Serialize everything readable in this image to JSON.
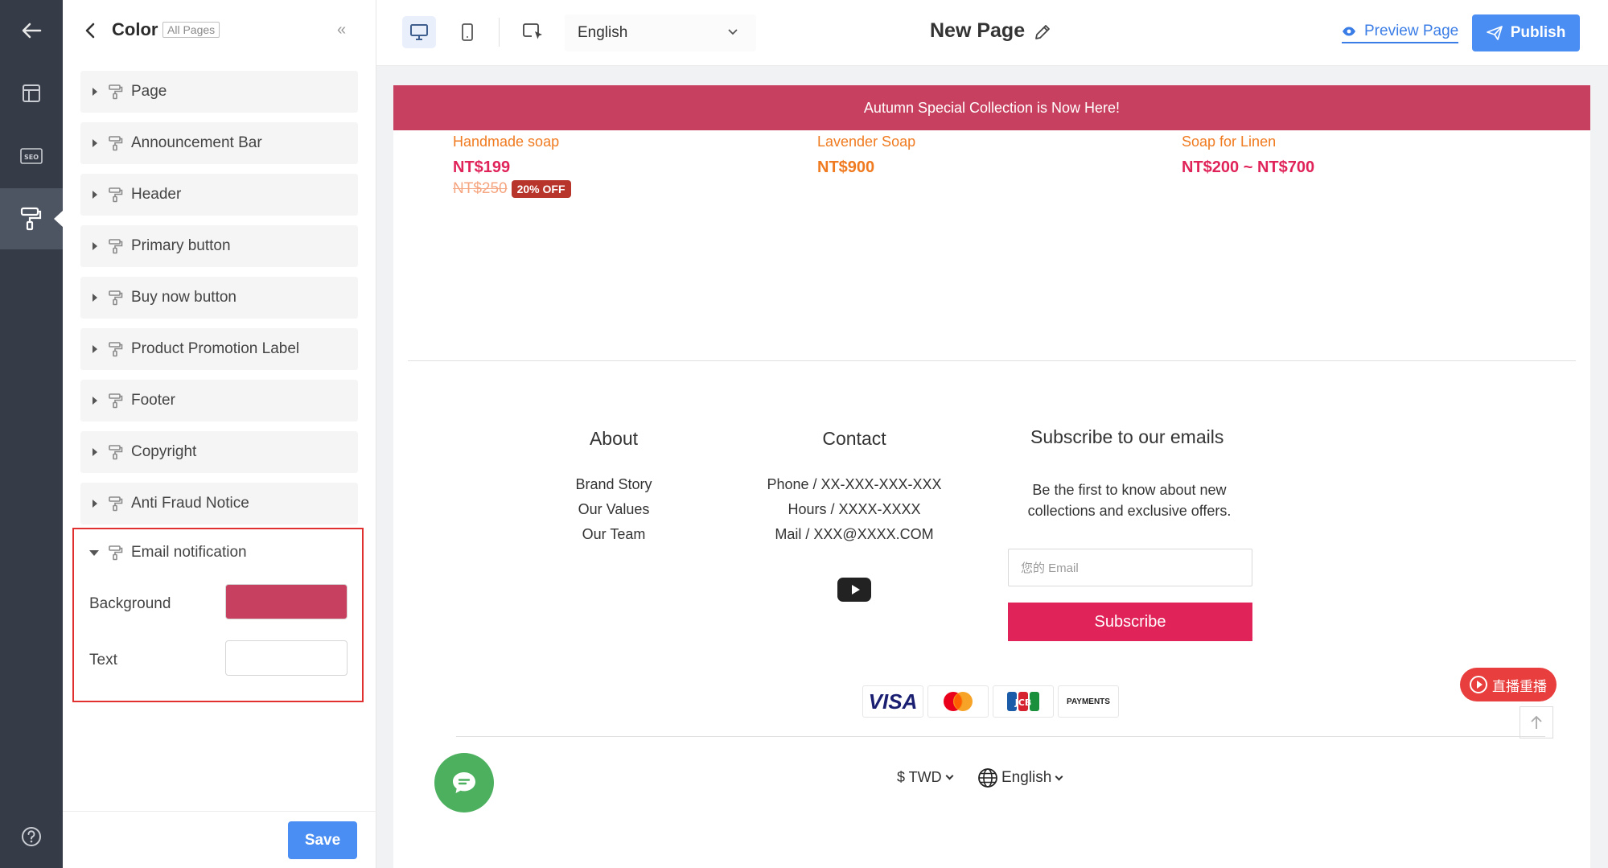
{
  "panel": {
    "title": "Color",
    "badge": "All Pages",
    "sections": [
      {
        "label": "Page"
      },
      {
        "label": "Announcement Bar"
      },
      {
        "label": "Header"
      },
      {
        "label": "Primary button"
      },
      {
        "label": "Buy now button"
      },
      {
        "label": "Product Promotion Label"
      },
      {
        "label": "Footer"
      },
      {
        "label": "Copyright"
      },
      {
        "label": "Anti Fraud Notice"
      }
    ],
    "email_section": {
      "label": "Email notification",
      "background_label": "Background",
      "background_color": "#c8405f",
      "text_label": "Text",
      "text_color": "#ffffff"
    },
    "save_label": "Save"
  },
  "toolbar": {
    "language": "English",
    "page_name": "New Page",
    "preview_label": "Preview Page",
    "publish_label": "Publish"
  },
  "preview": {
    "announcement": "Autumn Special Collection is Now Here!",
    "products": [
      {
        "name": "Handmade soap",
        "price": "NT$199",
        "old_price": "NT$250",
        "badge": "20% OFF",
        "price_color": "#e0245a"
      },
      {
        "name": "Lavender Soap",
        "price": "NT$900",
        "price_color": "#f07a1f"
      },
      {
        "name": "Soap for Linen",
        "price": "NT$200 ~ NT$700",
        "price_color": "#e0245a"
      }
    ],
    "footer": {
      "about": {
        "heading": "About",
        "links": [
          "Brand Story",
          "Our Values",
          "Our Team"
        ]
      },
      "contact": {
        "heading": "Contact",
        "lines": [
          "Phone / XX-XXX-XXX-XXX",
          "Hours / XXXX-XXXX",
          "Mail / XXX@XXXX.COM"
        ]
      },
      "subscribe": {
        "heading": "Subscribe to our emails",
        "desc_line1": "Be the first to know about new",
        "desc_line2": "collections and exclusive offers.",
        "email_placeholder": "您的 Email",
        "button": "Subscribe"
      },
      "payments": [
        "VISA",
        "mastercard",
        "JCB",
        "PAYMENTS"
      ],
      "currency": "$ TWD",
      "language": "English"
    },
    "live_replay": "直播重播"
  },
  "colors": {
    "accent": "#4a8ef3",
    "announcement_bg": "#c8405f",
    "rail_bg": "#353b47",
    "highlight_border": "#e0302f",
    "subscribe_bg": "#e0245a",
    "chat_bg": "#4cb05f"
  }
}
